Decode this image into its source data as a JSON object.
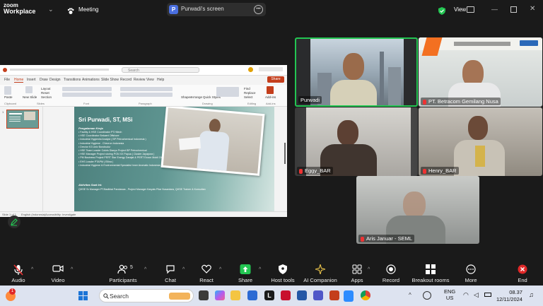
{
  "app": {
    "brand_line1": "zoom",
    "brand_line2": "Workplace",
    "meeting_label": "Meeting",
    "share_initial": "P",
    "share_label": "Purwadi's screen",
    "view_label": "View",
    "accent": "#2d8cff"
  },
  "powerpoint": {
    "search_placeholder": "Search",
    "share_label": "Share",
    "menu": [
      "File",
      "Home",
      "Insert",
      "Draw",
      "Design",
      "Transitions",
      "Animations",
      "Slide Show",
      "Record",
      "Review",
      "View",
      "Help"
    ],
    "ribbon_groups": [
      "Clipboard",
      "Slides",
      "Font",
      "Paragraph",
      "Drawing",
      "Editing",
      "Add-ins"
    ],
    "ribbon_buttons": [
      "Paste",
      "New Slide",
      "Layout",
      "Reset",
      "Section",
      "Shapes",
      "Arrange",
      "Quick Styles",
      "Find",
      "Replace",
      "Select",
      "Add-ins"
    ],
    "thumb_number": "1",
    "status_left": "Slide 1 of 1",
    "status_lang": "English (Indonesia)",
    "status_access": "Accessibility: Investigate",
    "slide": {
      "title": "Sri Purwadi, ST, MSi",
      "subtitle": "Pengalaman Kerja",
      "items": [
        "Facility & HSE Coordinator PT.Hitech",
        "HSE Coordinator Bekaert Offshore",
        "Industrial Hygienist Analyst ( BP Petrochemical Indonesia )",
        "Industrial Hygiene . Chevron Indonesia",
        "Drector K3 Univ Borobudur",
        "HSE Team Leader Cokris Dianyo Project BP Petrochemical",
        "HSE Manager Project storing PGN XX Papua ( Cluster Jayapura )",
        "PM Business Project PERT Star Energy Darajat & PERT Exxon Mobil Oil",
        "EHS Leader PTAPM ( Ellina )",
        "Industrial Hygiene & Environmental Specialist Inner Aromatic Indonesia"
      ],
      "subtitle2": "Aktivitas Saat Ini:",
      "footer": "QHSE Sr Manager PT.Badiklat Pandawas , Project Manager Karyais Pilar Nusantara, QHSE Trainer & Konsultan"
    }
  },
  "participants": [
    {
      "name": "Purwadi",
      "muted": false,
      "active": true
    },
    {
      "name": "PT. Betracom Gemilang Nusa",
      "muted": true
    },
    {
      "name": "Eggy_BAR",
      "muted": true
    },
    {
      "name": "Henry_BAR",
      "muted": true
    },
    {
      "name": "Aris Januar - SEML",
      "muted": true
    }
  ],
  "toolbar": {
    "audio": "Audio",
    "video": "Video",
    "participants": "Participants",
    "participants_count": "5",
    "chat": "Chat",
    "react": "React",
    "share": "Share",
    "host_tools": "Host tools",
    "ai_companion": "AI Companion",
    "apps": "Apps",
    "record": "Record",
    "breakout": "Breakout rooms",
    "more": "More",
    "end": "End"
  },
  "taskbar": {
    "notification_count": "1",
    "search_placeholder": "Search",
    "lang_line1": "ENG",
    "lang_line2": "US",
    "time": "08.37",
    "date": "12/11/2024"
  }
}
